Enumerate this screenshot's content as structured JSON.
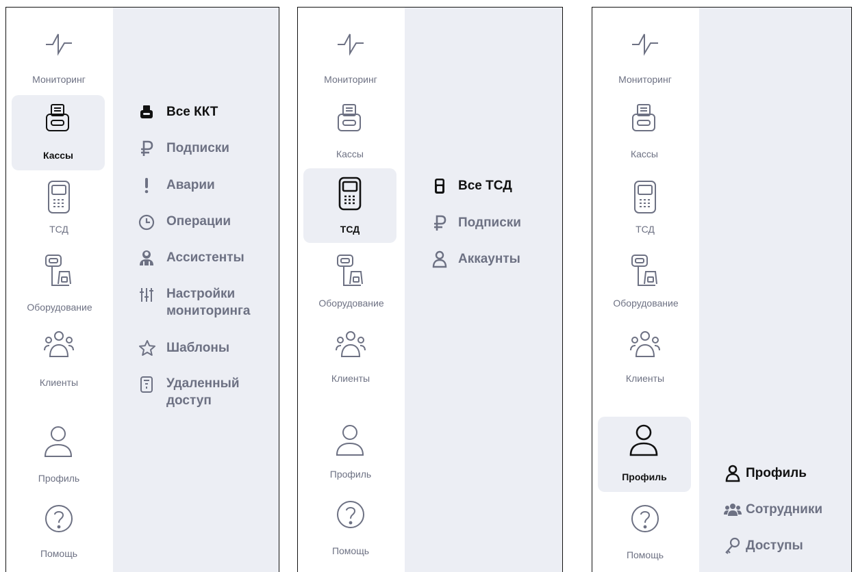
{
  "colors": {
    "rail_bg": "#ffffff",
    "submenu_bg": "#eceef4",
    "active_bg": "#eceef4",
    "inactive": "#6d7183",
    "active": "#111111"
  },
  "panels": [
    {
      "nav": {
        "monitoring": "Мониторинг",
        "registers": "Кассы",
        "tsd": "ТСД",
        "equipment": "Оборудование",
        "clients": "Клиенты",
        "profile": "Профиль",
        "help": "Помощь"
      },
      "active_nav": "registers",
      "menu": [
        {
          "icon": "printer-icon",
          "label": "Все ККТ",
          "active": true
        },
        {
          "icon": "ruble-icon",
          "label": "Подписки"
        },
        {
          "icon": "exclamation-icon",
          "label": "Аварии"
        },
        {
          "icon": "clock-icon",
          "label": "Операции"
        },
        {
          "icon": "assistant-icon",
          "label": "Ассистенты"
        },
        {
          "icon": "sliders-icon",
          "label": "Настройки мониторинга"
        },
        {
          "icon": "star-icon",
          "label": "Шаблоны"
        },
        {
          "icon": "remote-icon",
          "label": "Удаленный доступ"
        }
      ]
    },
    {
      "nav": {
        "monitoring": "Мониторинг",
        "registers": "Кассы",
        "tsd": "ТСД",
        "equipment": "Оборудование",
        "clients": "Клиенты",
        "profile": "Профиль",
        "help": "Помощь"
      },
      "active_nav": "tsd",
      "menu": [
        {
          "icon": "scanner-icon",
          "label": "Все ТСД",
          "active": true
        },
        {
          "icon": "ruble-icon",
          "label": "Подписки"
        },
        {
          "icon": "user-icon",
          "label": "Аккаунты"
        }
      ]
    },
    {
      "nav": {
        "monitoring": "Мониторинг",
        "registers": "Кассы",
        "tsd": "ТСД",
        "equipment": "Оборудование",
        "clients": "Клиенты",
        "profile": "Профиль",
        "help": "Помощь"
      },
      "active_nav": "profile",
      "menu": [
        {
          "icon": "user-icon",
          "label": "Профиль",
          "active": true
        },
        {
          "icon": "staff-icon",
          "label": "Сотрудники"
        },
        {
          "icon": "key-icon",
          "label": "Доступы"
        }
      ]
    }
  ]
}
